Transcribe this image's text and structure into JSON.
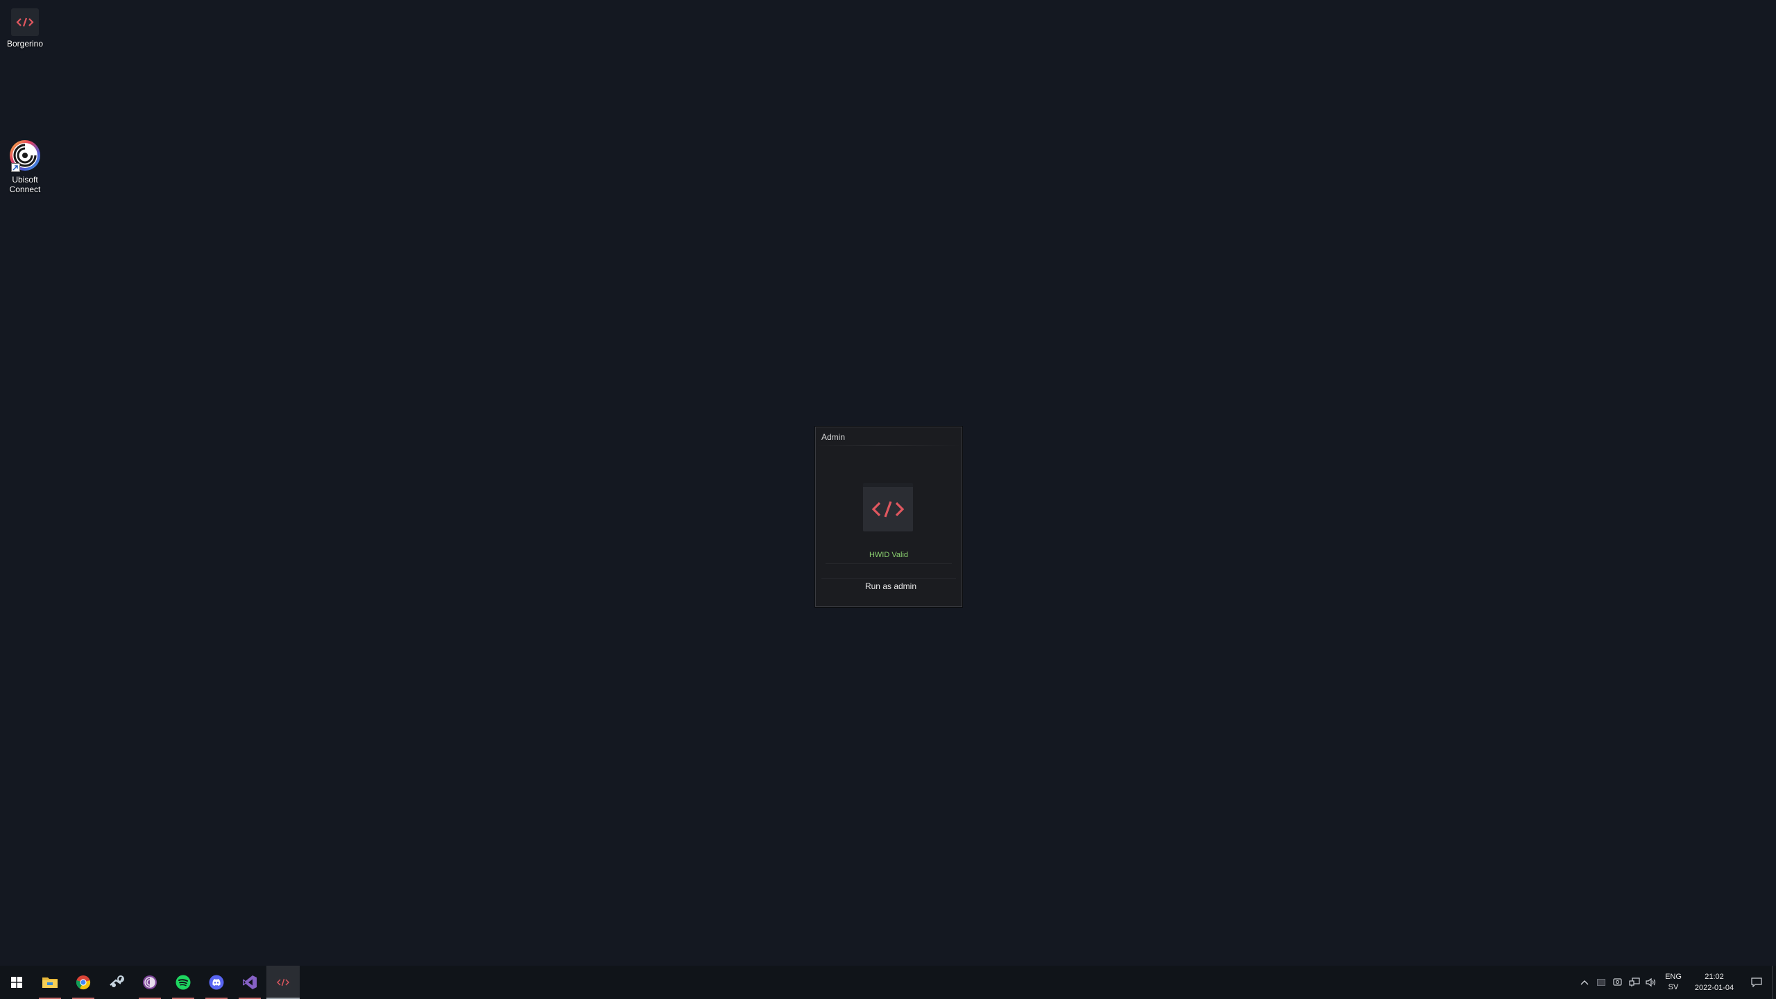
{
  "desktop": {
    "icons": [
      {
        "label": "Borgerino",
        "icon": "code-brackets-icon"
      },
      {
        "label": "Ubisoft\nConnect",
        "icon": "ubisoft-swirl-icon"
      }
    ]
  },
  "window": {
    "title": "Admin",
    "logo_icon": "code-brackets-icon",
    "status": "HWID Valid",
    "status_color": "#8bd06f",
    "button_label": "Run as admin",
    "accent_color": "#e0575f"
  },
  "taskbar": {
    "apps": [
      {
        "name": "Start",
        "icon": "windows-icon"
      },
      {
        "name": "File Explorer",
        "icon": "folder-icon"
      },
      {
        "name": "Google Chrome",
        "icon": "chrome-icon"
      },
      {
        "name": "Steam",
        "icon": "steam-icon"
      },
      {
        "name": "Tor Browser",
        "icon": "tor-icon"
      },
      {
        "name": "Spotify",
        "icon": "spotify-icon"
      },
      {
        "name": "Discord",
        "icon": "discord-icon"
      },
      {
        "name": "Visual Studio",
        "icon": "visual-studio-icon"
      },
      {
        "name": "Borgerino",
        "icon": "code-brackets-icon"
      }
    ],
    "tray": {
      "lang_top": "ENG",
      "lang_bottom": "SV",
      "time": "21:02",
      "date": "2022-01-04"
    }
  }
}
